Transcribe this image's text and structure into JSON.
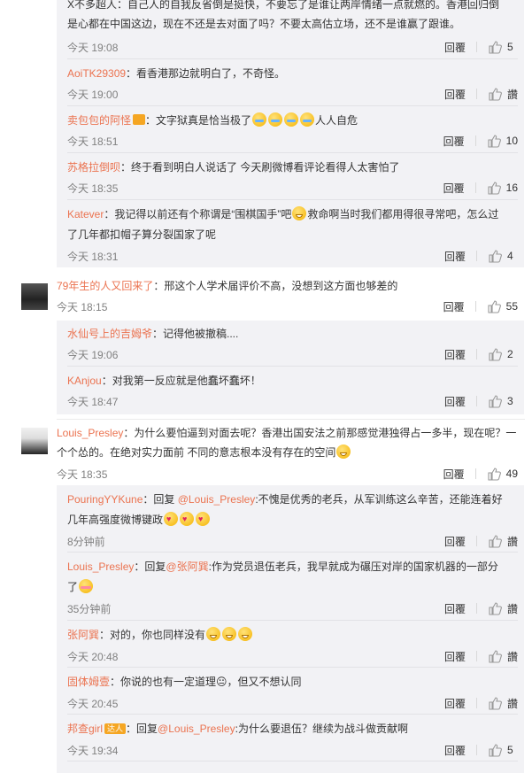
{
  "labels": {
    "reply": "回覆",
    "like_zero": "讚"
  },
  "comments": {
    "n1": {
      "user": "",
      "text": "X不多超人：自己人的自我反省倒是挺快，不要忘了是谁让两岸情绪一点就燃的。香港回归倒",
      "text2": "是心都在中国这边，现在不还是去对面了吗？不要太高估立场，还不是谁赢了跟谁。",
      "time": "今天 19:08",
      "likes": "5"
    },
    "n2": {
      "user": "AoiTK29309",
      "text": "：看香港那边就明白了，不奇怪。",
      "time": "今天 19:00",
      "likes": "讚"
    },
    "n3": {
      "user": "卖包包的阿怪",
      "text": "：文字狱真是恰当极了",
      "text_after": "人人自危",
      "time": "今天 18:51",
      "likes": "10"
    },
    "n4": {
      "user": "苏格拉倒呗",
      "text": "：终于看到明白人说话了 今天刷微博看评论看得人太害怕了",
      "time": "今天 18:35",
      "likes": "16"
    },
    "n5": {
      "user": "Katever",
      "text": "：我记得以前还有个称谓是“围棋国手”吧",
      "text_after": "救命啊当时我们都用得很寻常吧，怎么过",
      "text2": "了几年都扣帽子算分裂国家了呢",
      "time": "今天 18:31",
      "likes": "4"
    },
    "t1": {
      "user": "79年生的人又回来了",
      "text": "：邢这个人学术届评价不高，没想到这方面也够差的",
      "time": "今天 18:15",
      "likes": "55"
    },
    "n6": {
      "user": "水仙号上的吉姆爷",
      "text": "：记得他被撤稿....",
      "time": "今天 19:06",
      "likes": "2"
    },
    "n7": {
      "user": "KAnjou",
      "text": "：对我第一反应就是他蠢坏蠢坏！",
      "time": "今天 18:47",
      "likes": "3"
    },
    "t2": {
      "user": "Louis_Presley",
      "text": "：为什么要怕逼到对面去呢？香港出国安法之前那感觉港独得占一多半，现在呢？一",
      "text2": "个个怂的。在绝对实力面前 不同的意志根本没有存在的空间",
      "time": "今天 18:35",
      "likes": "49"
    },
    "n8": {
      "user": "PouringYYKune",
      "text": "：回复 ",
      "mention": "@Louis_Presley",
      "text_mid": ":不愧是优秀的老兵，从军训练这么辛苦，还能连着好",
      "text2": "几年高强度微博键政",
      "time": "8分钟前",
      "likes": "讚"
    },
    "n9": {
      "user": "Louis_Presley",
      "text": "：回复",
      "mention": "@张阿巽",
      "text_mid": ":作为党员退伍老兵，我早就成为碾压对岸的国家机器的一部分",
      "text2": "了",
      "time": "35分钟前",
      "likes": "讚"
    },
    "n10": {
      "user": "张阿巽",
      "text": "：对的，你也同样没有",
      "time": "今天 20:48",
      "likes": "讚"
    },
    "n11": {
      "user": "固体姆壹",
      "text": "：你说的也有一定道理😐，但又不想认同",
      "time": "今天 20:45",
      "likes": "讚"
    },
    "n12": {
      "user": "邦查girl",
      "badge": "达人",
      "text": "：回复",
      "mention": "@Louis_Presley",
      "text_mid": ":为什么要退伍？继续为战斗做贡献啊",
      "time": "今天 19:34",
      "likes": "5"
    }
  }
}
